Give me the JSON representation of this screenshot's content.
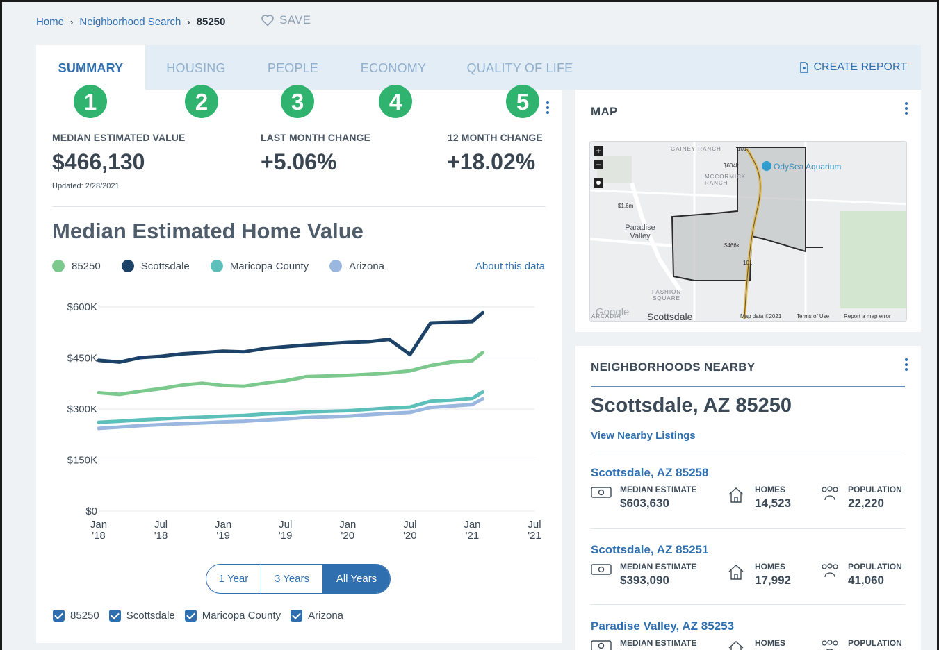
{
  "breadcrumb": {
    "home": "Home",
    "search": "Neighborhood Search",
    "current": "85250"
  },
  "save": {
    "label": "SAVE"
  },
  "tabs": [
    {
      "label": "SUMMARY",
      "active": true
    },
    {
      "label": "HOUSING"
    },
    {
      "label": "PEOPLE"
    },
    {
      "label": "ECONOMY"
    },
    {
      "label": "QUALITY OF LIFE"
    }
  ],
  "create_report": {
    "label": "CREATE REPORT"
  },
  "markers": [
    "1",
    "2",
    "3",
    "4",
    "5"
  ],
  "stats": {
    "median": {
      "label": "MEDIAN ESTIMATED VALUE",
      "value": "$466,130",
      "updated": "Updated: 2/28/2021"
    },
    "last_month": {
      "label": "LAST MONTH CHANGE",
      "value": "+5.06%"
    },
    "twelve_month": {
      "label": "12 MONTH CHANGE",
      "value": "+18.02%"
    }
  },
  "chart_section": {
    "title": "Median Estimated Home Value",
    "about": "About this data",
    "range_buttons": [
      "1 Year",
      "3 Years",
      "All Years"
    ],
    "selected_range": "All Years",
    "checkboxes": [
      "85250",
      "Scottsdale",
      "Maricopa County",
      "Arizona"
    ]
  },
  "chart_data": {
    "type": "line",
    "x": [
      "2018-01",
      "2018-03",
      "2018-05",
      "2018-07",
      "2018-09",
      "2018-11",
      "2019-01",
      "2019-03",
      "2019-05",
      "2019-07",
      "2019-09",
      "2019-11",
      "2020-01",
      "2020-03",
      "2020-05",
      "2020-07",
      "2020-09",
      "2020-11",
      "2021-01",
      "2021-02"
    ],
    "x_ticks": [
      {
        "label": "Jan",
        "year": "'18"
      },
      {
        "label": "Jul",
        "year": "'18"
      },
      {
        "label": "Jan",
        "year": "'19"
      },
      {
        "label": "Jul",
        "year": "'19"
      },
      {
        "label": "Jan",
        "year": "'20"
      },
      {
        "label": "Jul",
        "year": "'20"
      },
      {
        "label": "Jan",
        "year": "'21"
      },
      {
        "label": "Jul",
        "year": "'21"
      }
    ],
    "y_ticks": [
      "$0",
      "$150K",
      "$300K",
      "$450K",
      "$600K"
    ],
    "y_tick_values": [
      0,
      150000,
      300000,
      450000,
      600000
    ],
    "ylim": [
      0,
      600000
    ],
    "grid": true,
    "series": [
      {
        "name": "85250",
        "color": "#7cc98d",
        "values": [
          348000,
          343000,
          352000,
          360000,
          370000,
          376000,
          369000,
          367000,
          376000,
          383000,
          395000,
          397000,
          399000,
          402000,
          406000,
          412000,
          428000,
          438000,
          442000,
          466000
        ]
      },
      {
        "name": "Scottsdale",
        "color": "#1d4268",
        "values": [
          443000,
          438000,
          451000,
          455000,
          462000,
          466000,
          470000,
          468000,
          478000,
          483000,
          488000,
          492000,
          496000,
          498000,
          505000,
          460000,
          553000,
          555000,
          557000,
          583000
        ]
      },
      {
        "name": "Maricopa County",
        "color": "#5dbfb9",
        "values": [
          261000,
          264000,
          268000,
          271000,
          274000,
          276000,
          279000,
          281000,
          285000,
          288000,
          291000,
          293000,
          295000,
          299000,
          303000,
          306000,
          323000,
          326000,
          331000,
          350000
        ]
      },
      {
        "name": "Arizona",
        "color": "#9ab7df",
        "values": [
          243000,
          247000,
          251000,
          254000,
          257000,
          259000,
          262000,
          264000,
          268000,
          271000,
          275000,
          277000,
          279000,
          283000,
          287000,
          290000,
          305000,
          309000,
          313000,
          330000
        ]
      }
    ]
  },
  "map": {
    "title": "MAP",
    "labels": {
      "gainey": "GAINEY RANCH",
      "mccormick": "MCCORMICK RANCH",
      "odysea": "OdySea Aquarium",
      "paradise": "Paradise Valley",
      "fashion": "FASHION SQUARE",
      "arcadia": "ARCADIA",
      "google": "Google",
      "scottsdale": "Scottsdale",
      "price_a": "$604k",
      "price_b": "$1.6m",
      "price_c": "$466k",
      "route_a": "101",
      "route_b": "101",
      "footer_a": "Map data ©2021",
      "footer_b": "Terms of Use",
      "footer_c": "Report a map error"
    }
  },
  "nearby": {
    "title": "NEIGHBORHOODS NEARBY",
    "heading": "Scottsdale, AZ 85250",
    "link": "View Nearby Listings",
    "items": [
      {
        "name": "Scottsdale, AZ 85258",
        "median_label": "MEDIAN ESTIMATE",
        "median": "$603,630",
        "homes_label": "HOMES",
        "homes": "14,523",
        "pop_label": "POPULATION",
        "pop": "22,220"
      },
      {
        "name": "Scottsdale, AZ 85251",
        "median_label": "MEDIAN ESTIMATE",
        "median": "$393,090",
        "homes_label": "HOMES",
        "homes": "17,992",
        "pop_label": "POPULATION",
        "pop": "41,060"
      },
      {
        "name": "Paradise Valley, AZ 85253",
        "median_label": "MEDIAN ESTIMATE",
        "median": "",
        "homes_label": "HOMES",
        "homes": "",
        "pop_label": "POPULATION",
        "pop": ""
      }
    ]
  },
  "icons": {
    "save": "heart-icon",
    "report": "document-icon",
    "menu": "kebab-icon",
    "money": "money-icon",
    "home": "house-icon",
    "population": "people-icon"
  },
  "colors": {
    "accent": "#2f6fb0",
    "marker": "#2fb36e"
  }
}
